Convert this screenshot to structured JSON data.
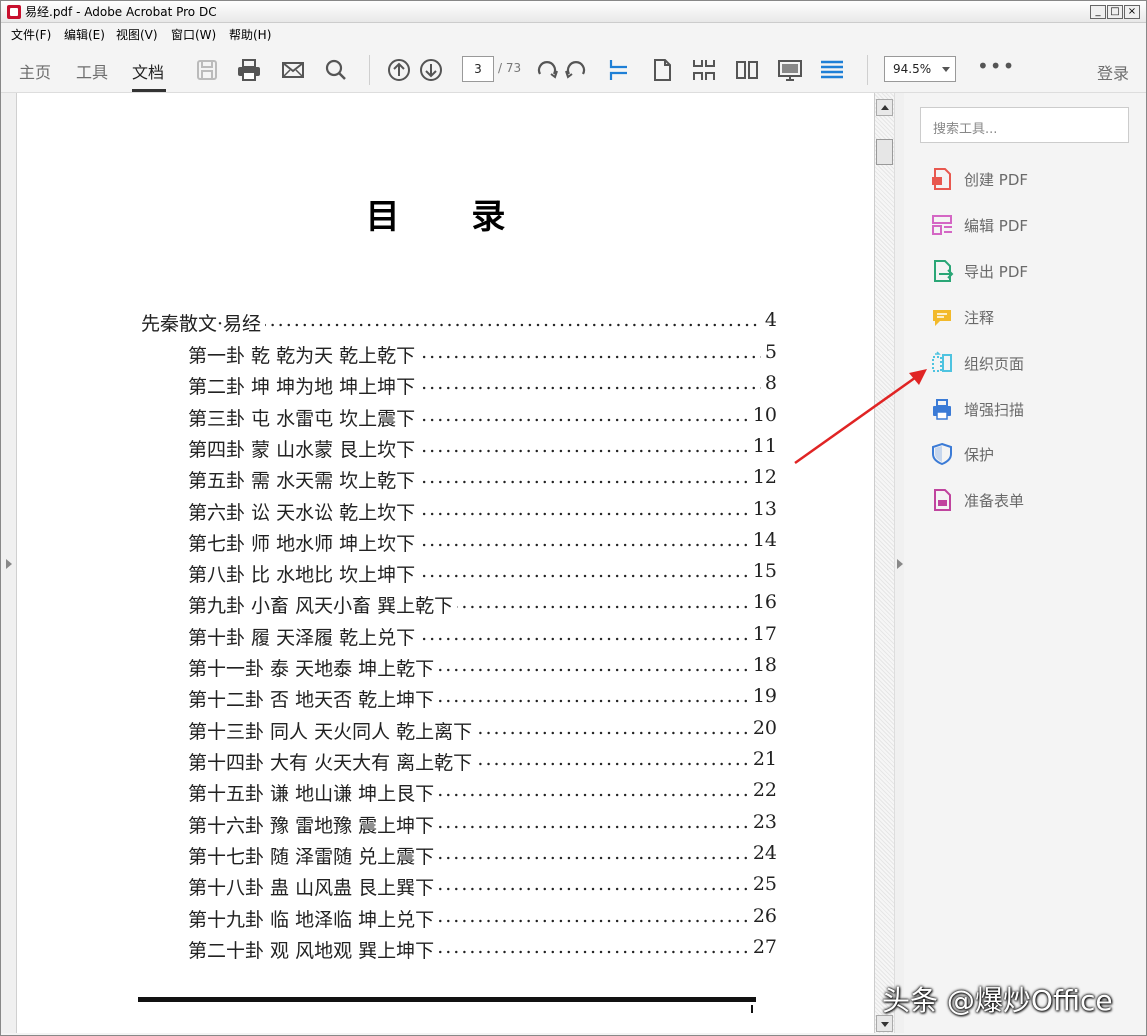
{
  "window": {
    "title": "易经.pdf - Adobe Acrobat Pro DC"
  },
  "menu": [
    "文件(F)",
    "编辑(E)",
    "视图(V)",
    "窗口(W)",
    "帮助(H)"
  ],
  "nav": {
    "home": "主页",
    "tools": "工具",
    "document": "文档"
  },
  "toolbar": {
    "page_current": "3",
    "page_total": "/ 73",
    "zoom": "94.5%",
    "more": "•••",
    "login": "登录"
  },
  "document": {
    "heading": "目 录",
    "toc": [
      {
        "title": "先秦散文·易经",
        "page": "4",
        "level": 0
      },
      {
        "title": "第一卦 乾 乾为天 乾上乾下",
        "page": "5",
        "level": 1
      },
      {
        "title": "第二卦 坤 坤为地 坤上坤下",
        "page": "8",
        "level": 1
      },
      {
        "title": "第三卦 屯 水雷屯 坎上震下",
        "page": "10",
        "level": 1
      },
      {
        "title": "第四卦 蒙 山水蒙 艮上坎下",
        "page": "11",
        "level": 1
      },
      {
        "title": "第五卦 需 水天需 坎上乾下",
        "page": "12",
        "level": 1
      },
      {
        "title": "第六卦 讼 天水讼 乾上坎下",
        "page": "13",
        "level": 1
      },
      {
        "title": "第七卦 师 地水师 坤上坎下",
        "page": "14",
        "level": 1
      },
      {
        "title": "第八卦 比 水地比 坎上坤下",
        "page": "15",
        "level": 1
      },
      {
        "title": "第九卦 小畜 风天小畜 巽上乾下",
        "page": "16",
        "level": 1
      },
      {
        "title": "第十卦 履 天泽履 乾上兑下",
        "page": "17",
        "level": 1
      },
      {
        "title": "第十一卦 泰 天地泰 坤上乾下",
        "page": "18",
        "level": 1
      },
      {
        "title": "第十二卦 否 地天否 乾上坤下",
        "page": "19",
        "level": 1
      },
      {
        "title": "第十三卦 同人 天火同人 乾上离下",
        "page": "20",
        "level": 1
      },
      {
        "title": "第十四卦 大有 火天大有 离上乾下",
        "page": "21",
        "level": 1
      },
      {
        "title": "第十五卦 谦 地山谦 坤上艮下",
        "page": "22",
        "level": 1
      },
      {
        "title": "第十六卦 豫 雷地豫 震上坤下",
        "page": "23",
        "level": 1
      },
      {
        "title": "第十七卦 随 泽雷随 兑上震下",
        "page": "24",
        "level": 1
      },
      {
        "title": "第十八卦 蛊 山风蛊 艮上巽下",
        "page": "25",
        "level": 1
      },
      {
        "title": "第十九卦 临 地泽临 坤上兑下",
        "page": "26",
        "level": 1
      },
      {
        "title": "第二十卦 观 风地观 巽上坤下",
        "page": "27",
        "level": 1
      }
    ]
  },
  "tools_pane": {
    "search_placeholder": "搜索工具...",
    "items": [
      {
        "label": "创建 PDF",
        "icon": "create-pdf-icon",
        "color": "#e8584f"
      },
      {
        "label": "编辑 PDF",
        "icon": "edit-pdf-icon",
        "color": "#d466c4"
      },
      {
        "label": "导出 PDF",
        "icon": "export-pdf-icon",
        "color": "#2aa676"
      },
      {
        "label": "注释",
        "icon": "comment-icon",
        "color": "#f2b92b"
      },
      {
        "label": "组织页面",
        "icon": "organize-pages-icon",
        "color": "#4ec3e0"
      },
      {
        "label": "增强扫描",
        "icon": "enhance-scan-icon",
        "color": "#3b7bd6"
      },
      {
        "label": "保护",
        "icon": "protect-icon",
        "color": "#3b7bd6"
      },
      {
        "label": "准备表单",
        "icon": "prepare-form-icon",
        "color": "#c0449e"
      }
    ]
  },
  "watermark": "头条 @爆炒Office"
}
